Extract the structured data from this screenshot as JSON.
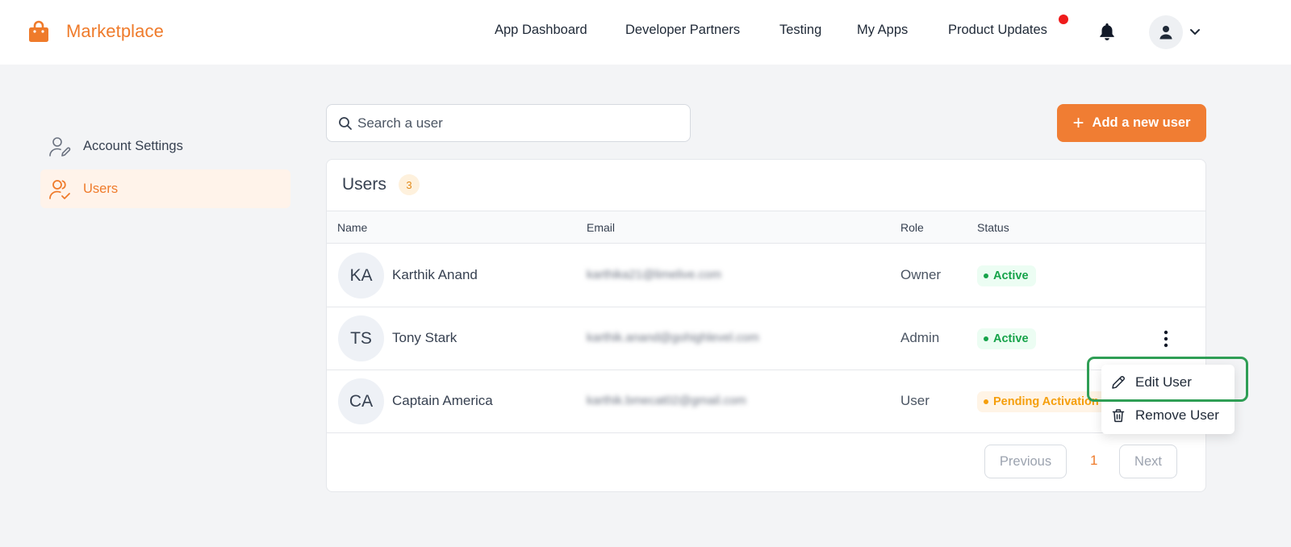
{
  "app": {
    "name": "Marketplace",
    "brand_color": "#ef7b2b"
  },
  "nav": {
    "items": [
      "App Dashboard",
      "Developer Partners",
      "Testing",
      "My Apps",
      "Product Updates"
    ],
    "icons": [
      "bell-icon",
      "user-icon",
      "chevron-down-icon"
    ]
  },
  "sidebar": {
    "items": [
      {
        "label": "Account Settings",
        "icon": "user-edit-icon",
        "active": false
      },
      {
        "label": "Users",
        "icon": "users-check-icon",
        "active": true
      }
    ]
  },
  "search": {
    "placeholder": "Search a user"
  },
  "add_button": {
    "label": "Add a new user"
  },
  "users_card": {
    "title": "Users",
    "count": "3",
    "columns": [
      "Name",
      "Email",
      "Role",
      "Status"
    ],
    "rows": [
      {
        "initials": "KA",
        "name": "Karthik Anand",
        "email": "karthika21@limelive.com",
        "role": "Owner",
        "status": "Active"
      },
      {
        "initials": "TS",
        "name": "Tony Stark",
        "email": "karthik.anand@gohighlevel.com",
        "role": "Admin",
        "status": "Active"
      },
      {
        "initials": "CA",
        "name": "Captain America",
        "email": "karthik.bmecat02@gmail.com",
        "role": "User",
        "status": "Pending Activation"
      }
    ]
  },
  "pagination": {
    "previous": "Previous",
    "page": "1",
    "next": "Next"
  },
  "row_menu": {
    "items": [
      "Edit User",
      "Remove User"
    ]
  },
  "colors": {
    "active_status": "#16a34a",
    "pending_status": "#f59e0b",
    "highlight": "#2f9e55",
    "notification": "#ef1b1b"
  }
}
